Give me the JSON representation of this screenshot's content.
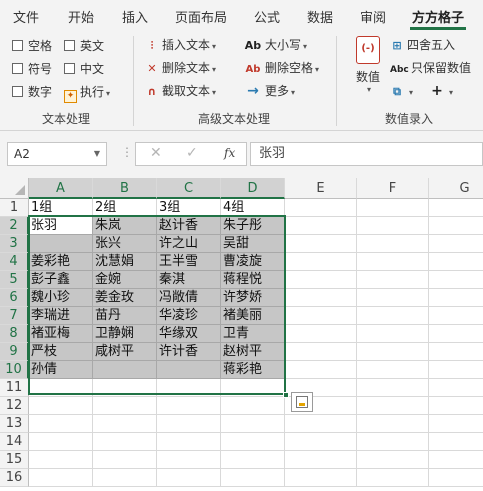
{
  "ribbon_tabs": [
    "文件",
    "开始",
    "插入",
    "页面布局",
    "公式",
    "数据",
    "审阅",
    "方方格子"
  ],
  "active_tab": "方方格子",
  "text_processing": {
    "group_label": "文本处理",
    "checkboxes": [
      "空格",
      "英文",
      "符号",
      "中文",
      "数字"
    ],
    "exec_label": "执行"
  },
  "advanced_text": {
    "group_label": "高级文本处理",
    "commands": [
      "插入文本",
      "删除文本",
      "截取文本",
      "大小写",
      "删除空格",
      "更多"
    ],
    "icon_text_case": "Ab",
    "icon_text_space": "Ab"
  },
  "numeric_entry": {
    "group_label": "数值录入",
    "big_button_label": "数值",
    "commands": [
      "四舍五入",
      "只保留数值"
    ],
    "icon_abc": "Abc"
  },
  "formula_bar": {
    "name_box": "A2",
    "fx": "fx",
    "value": "张羽"
  },
  "sheet": {
    "columns": [
      "A",
      "B",
      "C",
      "D",
      "E",
      "F",
      "G"
    ],
    "rows": [
      "1",
      "2",
      "3",
      "4",
      "5",
      "6",
      "7",
      "8",
      "9",
      "10",
      "11",
      "12",
      "13",
      "14",
      "15",
      "16"
    ],
    "cells": [
      [
        "1组",
        "2组",
        "3组",
        "4组"
      ],
      [
        "张羽",
        "朱岚",
        "赵计香",
        "朱子彤"
      ],
      [
        "",
        "张兴",
        "许之山",
        "吴甜"
      ],
      [
        "姜彩艳",
        "沈慧娟",
        "王半雪",
        "曹凌旋"
      ],
      [
        "彭子鑫",
        "金婉",
        "秦淇",
        "蒋程悦"
      ],
      [
        "魏小珍",
        "姜金玫",
        "冯敞倩",
        "许梦娇"
      ],
      [
        "李瑞进",
        "苗丹",
        "华凌珍",
        "褚美丽"
      ],
      [
        "褚亚梅",
        "卫静娴",
        "华缘双",
        "卫青"
      ],
      [
        "严枝",
        "咸树平",
        "许计香",
        "赵树平"
      ],
      [
        "孙倩",
        "",
        "",
        "蒋彩艳"
      ]
    ]
  },
  "colors": {
    "accent": "#217346",
    "selection": "#c6c6c6"
  }
}
